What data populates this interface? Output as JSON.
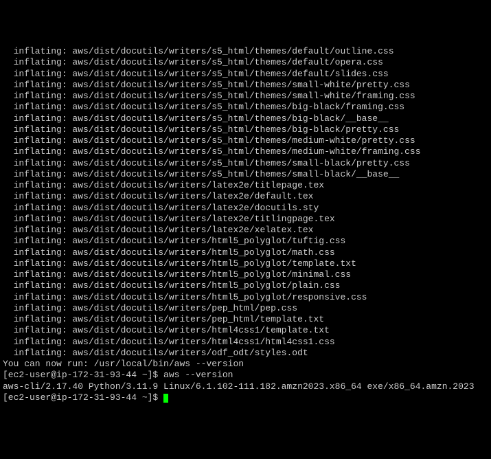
{
  "inflate_lines": [
    "  inflating: aws/dist/docutils/writers/s5_html/themes/default/outline.css",
    "  inflating: aws/dist/docutils/writers/s5_html/themes/default/opera.css",
    "  inflating: aws/dist/docutils/writers/s5_html/themes/default/slides.css",
    "  inflating: aws/dist/docutils/writers/s5_html/themes/small-white/pretty.css",
    "  inflating: aws/dist/docutils/writers/s5_html/themes/small-white/framing.css",
    "  inflating: aws/dist/docutils/writers/s5_html/themes/big-black/framing.css",
    "  inflating: aws/dist/docutils/writers/s5_html/themes/big-black/__base__",
    "  inflating: aws/dist/docutils/writers/s5_html/themes/big-black/pretty.css",
    "  inflating: aws/dist/docutils/writers/s5_html/themes/medium-white/pretty.css",
    "  inflating: aws/dist/docutils/writers/s5_html/themes/medium-white/framing.css",
    "  inflating: aws/dist/docutils/writers/s5_html/themes/small-black/pretty.css",
    "  inflating: aws/dist/docutils/writers/s5_html/themes/small-black/__base__",
    "  inflating: aws/dist/docutils/writers/latex2e/titlepage.tex",
    "  inflating: aws/dist/docutils/writers/latex2e/default.tex",
    "  inflating: aws/dist/docutils/writers/latex2e/docutils.sty",
    "  inflating: aws/dist/docutils/writers/latex2e/titlingpage.tex",
    "  inflating: aws/dist/docutils/writers/latex2e/xelatex.tex",
    "  inflating: aws/dist/docutils/writers/html5_polyglot/tuftig.css",
    "  inflating: aws/dist/docutils/writers/html5_polyglot/math.css",
    "  inflating: aws/dist/docutils/writers/html5_polyglot/template.txt",
    "  inflating: aws/dist/docutils/writers/html5_polyglot/minimal.css",
    "  inflating: aws/dist/docutils/writers/html5_polyglot/plain.css",
    "  inflating: aws/dist/docutils/writers/html5_polyglot/responsive.css",
    "  inflating: aws/dist/docutils/writers/pep_html/pep.css",
    "  inflating: aws/dist/docutils/writers/pep_html/template.txt",
    "  inflating: aws/dist/docutils/writers/html4css1/template.txt",
    "  inflating: aws/dist/docutils/writers/html4css1/html4css1.css",
    "  inflating: aws/dist/docutils/writers/odf_odt/styles.odt"
  ],
  "hint_line": "You can now run: /usr/local/bin/aws --version",
  "prompt1": "[ec2-user@ip-172-31-93-44 ~]$ ",
  "command1": "aws --version",
  "version_output": "aws-cli/2.17.40 Python/3.11.9 Linux/6.1.102-111.182.amzn2023.x86_64 exe/x86_64.amzn.2023",
  "prompt2": "[ec2-user@ip-172-31-93-44 ~]$ "
}
